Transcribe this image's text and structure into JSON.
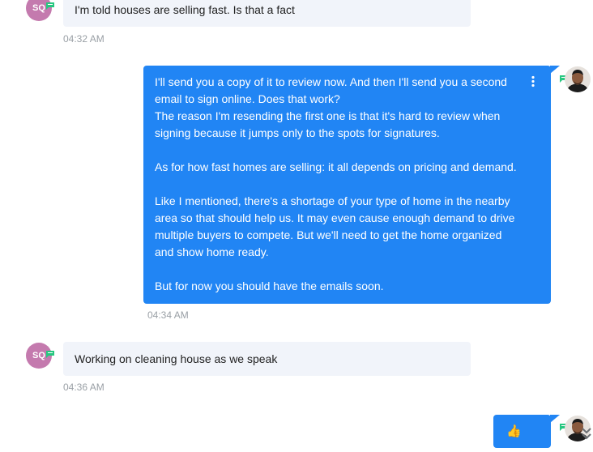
{
  "colors": {
    "incoming_bubble": "#f1f4fa",
    "outgoing_bubble": "#2185f4",
    "avatar_sq": "#c47aae",
    "chat_badge": "#27c780",
    "timestamp": "#9aa0a6"
  },
  "contact": {
    "initials": "SQ"
  },
  "messages": [
    {
      "direction": "incoming",
      "text": "I'm told houses are selling fast. Is that a fact",
      "time": "04:32 AM"
    },
    {
      "direction": "outgoing",
      "lines": [
        "I'll send you a copy of it to review now. And then I'll send you a second email to sign online. Does that work?",
        "The reason I'm resending the first one is that it's hard to review when signing because it jumps only to the spots for signatures.",
        "",
        "As for how fast homes are selling: it all depends on pricing and demand.",
        "",
        "Like I mentioned, there's a shortage of your type of home in the nearby area so that should help us. It may even cause enough demand to drive multiple buyers to compete. But we'll need to get the home organized and show home ready.",
        "",
        "But for now you should have the emails soon."
      ],
      "time": "04:34 AM"
    },
    {
      "direction": "incoming",
      "text": "Working on cleaning house as we speak",
      "time": "04:36 AM"
    },
    {
      "direction": "outgoing",
      "text": "👍"
    }
  ],
  "icons": {
    "more_menu": "vertical-dots-icon",
    "scroll_down": "double-chevron-down-icon",
    "chat_badge": "chat-bubble-icon"
  }
}
